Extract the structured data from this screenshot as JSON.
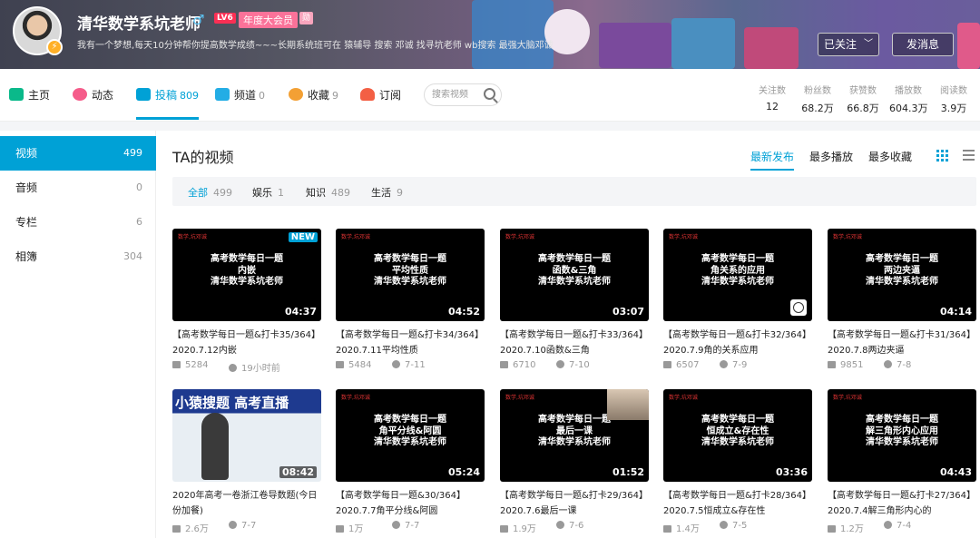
{
  "profile": {
    "name": "清华数学系坑老师",
    "gender_icon": "male-icon",
    "level": "LV6",
    "vip": "年度大会员",
    "sign": "我有一个梦想,每天10分钟帮你提高数学成绩~~~长期系统班可在 猿辅导 搜索 邓诚 找寻坑老师 wb搜索 最强大脑邓诚",
    "follow_label": "已关注",
    "message_label": "发消息"
  },
  "nav": {
    "items": [
      {
        "label": "主页",
        "count": "",
        "icon": "home-icon"
      },
      {
        "label": "动态",
        "count": "",
        "icon": "feed-icon"
      },
      {
        "label": "投稿",
        "count": "809",
        "icon": "upload-icon"
      },
      {
        "label": "频道",
        "count": "0",
        "icon": "channel-icon"
      },
      {
        "label": "收藏",
        "count": "9",
        "icon": "star-icon"
      },
      {
        "label": "订阅",
        "count": "",
        "icon": "heart-icon"
      }
    ],
    "search_placeholder": "搜索视频"
  },
  "stats": [
    {
      "label": "关注数",
      "value": "12"
    },
    {
      "label": "粉丝数",
      "value": "68.2万"
    },
    {
      "label": "获赞数",
      "value": "66.8万"
    },
    {
      "label": "播放数",
      "value": "604.3万"
    },
    {
      "label": "阅读数",
      "value": "3.9万"
    }
  ],
  "sidebar": [
    {
      "label": "视频",
      "count": "499"
    },
    {
      "label": "音频",
      "count": "0"
    },
    {
      "label": "专栏",
      "count": "6"
    },
    {
      "label": "相簿",
      "count": "304"
    }
  ],
  "main": {
    "title": "TA的视频",
    "sorts": [
      "最新发布",
      "最多播放",
      "最多收藏"
    ],
    "filters": [
      {
        "label": "全部",
        "count": "499"
      },
      {
        "label": "娱乐",
        "count": "1"
      },
      {
        "label": "知识",
        "count": "489"
      },
      {
        "label": "生活",
        "count": "9"
      }
    ]
  },
  "videos": [
    {
      "thumb_lines": [
        "高考数学每日一题",
        "内嵌",
        "清华数学系坑老师"
      ],
      "duration": "04:37",
      "title": "【高考数学每日一题&打卡35/364】2020.7.12内嵌",
      "views": "5284",
      "time": "19小时前",
      "badge": "NEW"
    },
    {
      "thumb_lines": [
        "高考数学每日一题",
        "平均性质",
        "清华数学系坑老师"
      ],
      "duration": "04:52",
      "title": "【高考数学每日一题&打卡34/364】2020.7.11平均性质",
      "views": "5484",
      "time": "7-11"
    },
    {
      "thumb_lines": [
        "高考数学每日一题",
        "函数&三角",
        "清华数学系坑老师"
      ],
      "duration": "03:07",
      "title": "【高考数学每日一题&打卡33/364】2020.7.10函数&三角",
      "views": "6710",
      "time": "7-10"
    },
    {
      "thumb_lines": [
        "高考数学每日一题",
        "角关系的应用",
        "清华数学系坑老师"
      ],
      "duration": "",
      "title": "【高考数学每日一题&打卡32/364】2020.7.9角的关系应用",
      "views": "6507",
      "time": "7-9"
    },
    {
      "thumb_lines": [
        "高考数学每日一题",
        "两边夹逼",
        "清华数学系坑老师"
      ],
      "duration": "04:14",
      "title": "【高考数学每日一题&打卡31/364】2020.7.8两边夹逼",
      "views": "9851",
      "time": "7-8"
    },
    {
      "thumb_lines": [
        "小猿搜题 高考直播"
      ],
      "duration": "08:42",
      "title": "2020年高考一卷浙江卷导数题(今日份加餐)",
      "views": "2.6万",
      "time": "7-7"
    },
    {
      "thumb_lines": [
        "高考数学每日一题",
        "角平分线&阿圆",
        "清华数学系坑老师"
      ],
      "duration": "05:24",
      "title": "【高考数学每日一题&30/364】2020.7.7角平分线&阿圆",
      "views": "1万",
      "time": "7-7"
    },
    {
      "thumb_lines": [
        "高考数学每日一题",
        "最后一课",
        "清华数学系坑老师"
      ],
      "duration": "01:52",
      "title": "【高考数学每日一题&打卡29/364】2020.7.6最后一课",
      "views": "1.9万",
      "time": "7-6"
    },
    {
      "thumb_lines": [
        "高考数学每日一题",
        "恒成立&存在性",
        "清华数学系坑老师"
      ],
      "duration": "03:36",
      "title": "【高考数学每日一题&打卡28/364】2020.7.5恒成立&存在性",
      "views": "1.4万",
      "time": "7-5"
    },
    {
      "thumb_lines": [
        "高考数学每日一题",
        "解三角形内心应用",
        "清华数学系坑老师"
      ],
      "duration": "04:43",
      "title": "【高考数学每日一题&打卡27/364】2020.7.4解三角形内心的",
      "views": "1.2万",
      "time": "7-4"
    }
  ],
  "thumb_tag": "数学,坑邓诚",
  "colors": {
    "accent": "#00a1d6",
    "vip_pink": "#fb7299",
    "level_red": "#fb2f54"
  }
}
